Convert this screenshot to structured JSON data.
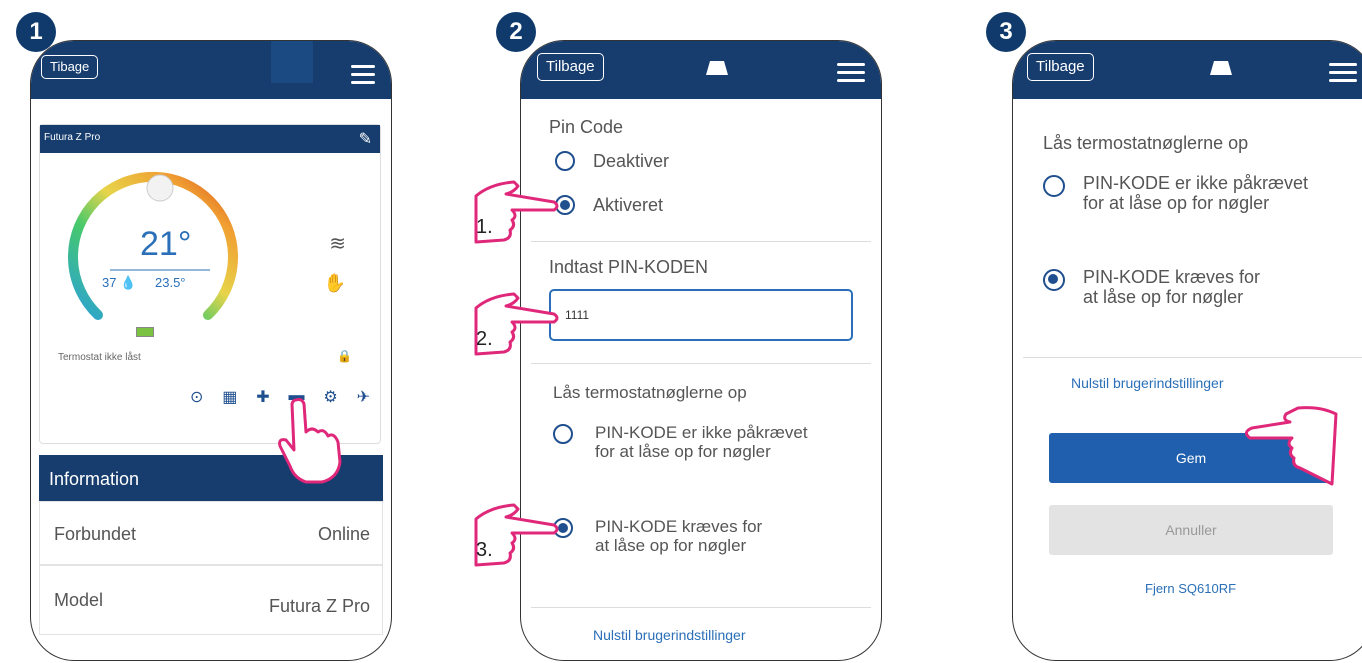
{
  "screens": [
    {
      "step": "1",
      "back_label": "Tibage",
      "device_name": "Futura Z Pro",
      "temperature": "21°",
      "humidity": "37",
      "setpoint": "23.5°",
      "lock_status": "Termostat ikke låst",
      "info_title": "Information",
      "rows": [
        {
          "label": "Forbundet",
          "value": "Online"
        },
        {
          "label": "Model",
          "value": "Futura Z Pro"
        }
      ]
    },
    {
      "step": "2",
      "back_label": "Tilbage",
      "pin_title": "Pin Code",
      "opt_disable": "Deaktiver",
      "opt_enable": "Aktiveret",
      "pin_label": "Indtast PIN-KODEN",
      "pin_value": "1111",
      "unlock_title": "Lås termostatnøglerne op",
      "unlock_opt1_line1": "PIN-KODE er ikke påkrævet",
      "unlock_opt1_line2": "for at låse op for nøgler",
      "unlock_opt2_line1": "PIN-KODE kræves for",
      "unlock_opt2_line2": "at låse op for nøgler",
      "reset_link": "Nulstil brugerindstillinger",
      "callouts": [
        "1.",
        "2.",
        "3."
      ]
    },
    {
      "step": "3",
      "back_label": "Tilbage",
      "unlock_title": "Lås termostatnøglerne op",
      "unlock_opt1_line1": "PIN-KODE er ikke påkrævet",
      "unlock_opt1_line2": "for at låse op for nøgler",
      "unlock_opt2_line1": "PIN-KODE kræves for",
      "unlock_opt2_line2": "at låse op for nøgler",
      "reset_link": "Nulstil brugerindstillinger",
      "save_label": "Gem",
      "cancel_label": "Annuller",
      "remove_label": "Fjern SQ610RF"
    }
  ],
  "colors": {
    "header": "#163d6e",
    "accent": "#1f5fae",
    "pointer": "#e0287a"
  }
}
